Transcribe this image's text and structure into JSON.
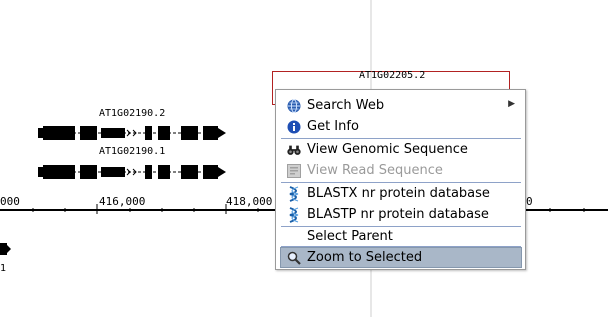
{
  "tracks": {
    "gene_labels": [
      {
        "id": "at1g02190-2",
        "label": "AT1G02190.2"
      },
      {
        "id": "at1g02190-1",
        "label": "AT1G02190.1"
      },
      {
        "id": "at1g02205-2",
        "label": "AT1G02205.2"
      }
    ],
    "cut_label_bottom_left": "1"
  },
  "ruler": {
    "ticks": [
      "000",
      "416,000",
      "418,000",
      "0"
    ]
  },
  "context_menu": {
    "items": [
      {
        "label": "Search Web",
        "icon": "globe-icon",
        "submenu": true,
        "enabled": true
      },
      {
        "label": "Get Info",
        "icon": "info-icon",
        "enabled": true
      },
      {
        "label": "View Genomic Sequence",
        "icon": "binoculars-icon",
        "enabled": true
      },
      {
        "label": "View Read Sequence",
        "icon": "read-sequence-icon",
        "enabled": false
      },
      {
        "label": "BLASTX nr protein database",
        "icon": "dna-helix-icon",
        "enabled": true
      },
      {
        "label": "BLASTP nr protein database",
        "icon": "dna-helix-icon",
        "enabled": true
      },
      {
        "label": "Select Parent",
        "icon": "",
        "enabled": true
      },
      {
        "label": "Zoom to Selected",
        "icon": "magnifier-icon",
        "enabled": true,
        "highlighted": true
      }
    ]
  },
  "colors": {
    "selection_box": "#b22222",
    "highlight": "#a9b7c8",
    "separator": "#8ea2c8"
  }
}
